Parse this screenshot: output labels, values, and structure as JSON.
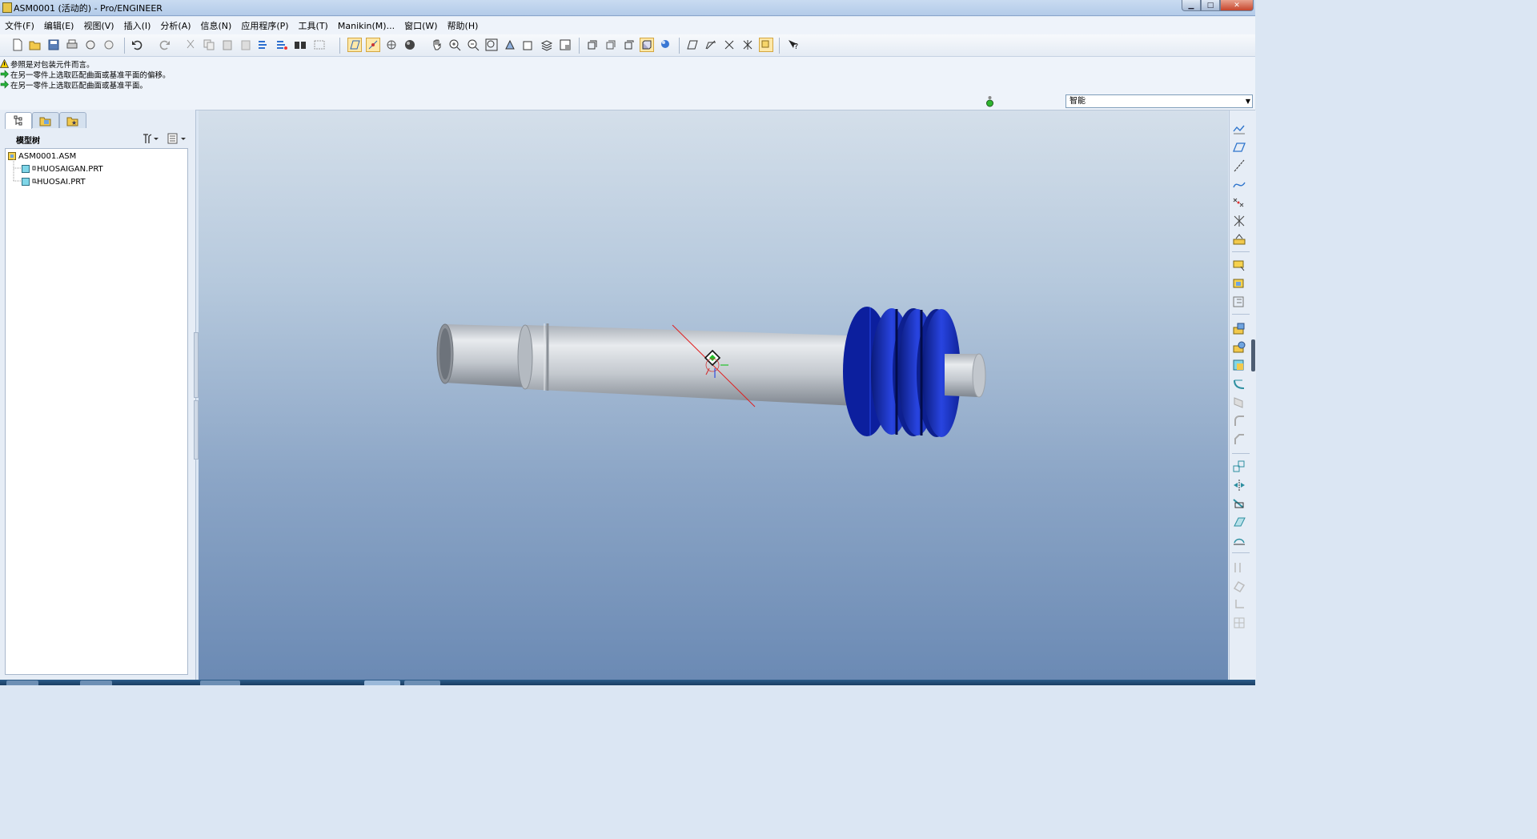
{
  "window": {
    "title": "ASM0001 (活动的) - Pro/ENGINEER",
    "min_glyph": "▁",
    "max_glyph": "□",
    "close_glyph": "✕"
  },
  "menu": {
    "items": [
      "文件(F)",
      "编辑(E)",
      "视图(V)",
      "插入(I)",
      "分析(A)",
      "信息(N)",
      "应用程序(P)",
      "工具(T)",
      "Manikin(M)...",
      "窗口(W)",
      "帮助(H)"
    ]
  },
  "messages": [
    {
      "icon": "warning-icon",
      "text": "参照是对包装元件而言。"
    },
    {
      "icon": "arrow-right-icon",
      "text": "在另一零件上选取匹配曲面或基准平面的偏移。"
    },
    {
      "icon": "arrow-right-icon",
      "text": "在另一零件上选取匹配曲面或基准平面。"
    }
  ],
  "filter": {
    "selected": "智能"
  },
  "model_tree": {
    "label": "模型树",
    "root": "ASM0001.ASM",
    "children": [
      "HUOSAIGAN.PRT",
      "HUOSAI.PRT"
    ]
  },
  "colors": {
    "shaft": "#c8cdd3",
    "piston": "#1a2fd0",
    "background_top": "#d4dfea",
    "background_bottom": "#6b8ab4"
  }
}
